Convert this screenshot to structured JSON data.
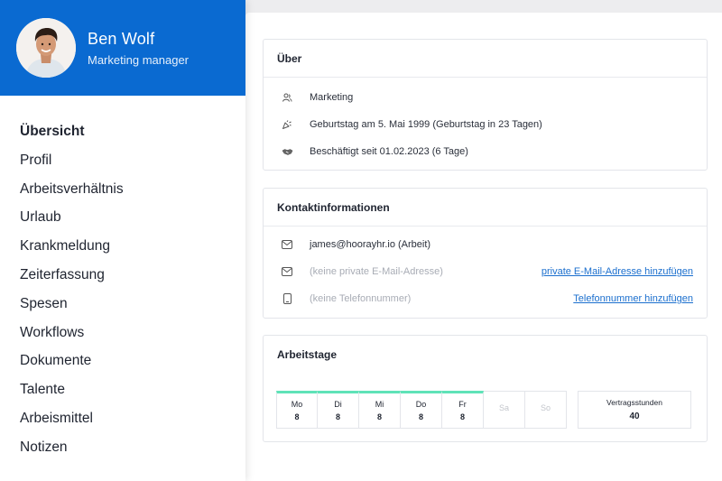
{
  "profile": {
    "name": "Ben Wolf",
    "role": "Marketing manager",
    "avatar_icon": "person-avatar"
  },
  "nav": {
    "items": [
      {
        "label": "Übersicht",
        "active": true
      },
      {
        "label": "Profil"
      },
      {
        "label": "Arbeitsverhältnis"
      },
      {
        "label": "Urlaub"
      },
      {
        "label": "Krankmeldung"
      },
      {
        "label": "Zeiterfassung"
      },
      {
        "label": "Spesen"
      },
      {
        "label": "Workflows"
      },
      {
        "label": "Dokumente"
      },
      {
        "label": "Talente"
      },
      {
        "label": "Arbeismittel"
      },
      {
        "label": "Notizen"
      }
    ]
  },
  "about": {
    "title": "Über",
    "department": "Marketing",
    "birthday": "Geburtstag am 5. Mai 1999 (Geburtstag in 23 Tagen)",
    "employment": "Beschäftigt seit 01.02.2023 (6 Tage)"
  },
  "contact": {
    "title": "Kontaktinformationen",
    "work_email": "james@hoorayhr.io (Arbeit)",
    "private_email_placeholder": "(keine private E-Mail-Adresse)",
    "private_email_action": "private E-Mail-Adresse hinzufügen",
    "phone_placeholder": "(keine Telefonnummer)",
    "phone_action": "Telefonnummer hinzufügen"
  },
  "workdays": {
    "title": "Arbeitstage",
    "days": [
      {
        "name": "Mo",
        "hours": "8",
        "active": true
      },
      {
        "name": "Di",
        "hours": "8",
        "active": true
      },
      {
        "name": "Mi",
        "hours": "8",
        "active": true
      },
      {
        "name": "Do",
        "hours": "8",
        "active": true
      },
      {
        "name": "Fr",
        "hours": "8",
        "active": true
      },
      {
        "name": "Sa",
        "hours": "",
        "active": false
      },
      {
        "name": "So",
        "hours": "",
        "active": false
      }
    ],
    "contract_label": "Vertragsstunden",
    "contract_hours": "40"
  },
  "colors": {
    "accent": "#0a6ad1",
    "link": "#1b6fce",
    "workday_bar": "#5fe3b8"
  }
}
